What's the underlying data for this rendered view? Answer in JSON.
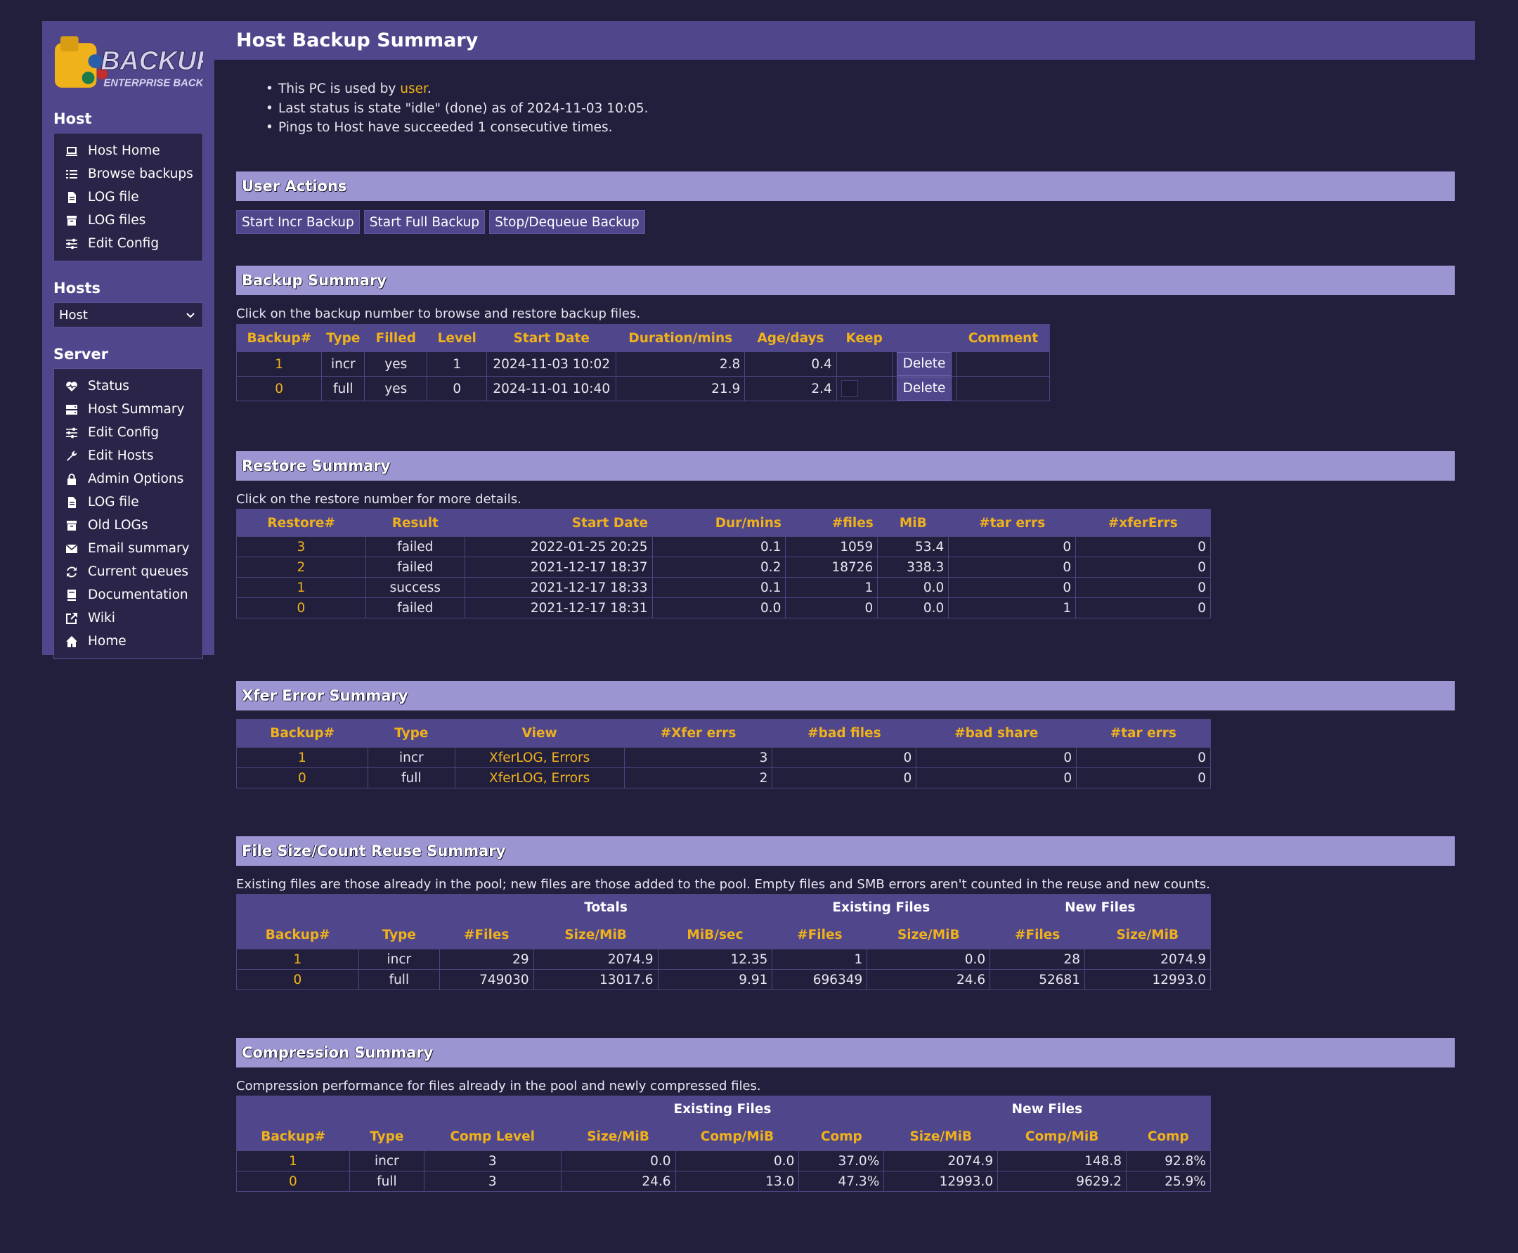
{
  "page": {
    "title": "Host Backup Summary"
  },
  "logo": {
    "main": "BACKUP PC",
    "sub": "ENTERPRISE BACKUP"
  },
  "sidebar": {
    "host_heading": "Host",
    "host_items": [
      {
        "label": "Host Home",
        "icon": "laptop-icon"
      },
      {
        "label": "Browse backups",
        "icon": "list-icon"
      },
      {
        "label": "LOG file",
        "icon": "file-icon"
      },
      {
        "label": "LOG files",
        "icon": "archive-icon"
      },
      {
        "label": "Edit Config",
        "icon": "sliders-icon"
      }
    ],
    "hosts_heading": "Hosts",
    "host_select_value": "Host",
    "server_heading": "Server",
    "server_items": [
      {
        "label": "Status",
        "icon": "heartbeat-icon"
      },
      {
        "label": "Host Summary",
        "icon": "server-icon"
      },
      {
        "label": "Edit Config",
        "icon": "sliders-icon"
      },
      {
        "label": "Edit Hosts",
        "icon": "wrench-icon"
      },
      {
        "label": "Admin Options",
        "icon": "lock-icon"
      },
      {
        "label": "LOG file",
        "icon": "file-icon"
      },
      {
        "label": "Old LOGs",
        "icon": "archive-icon"
      },
      {
        "label": "Email summary",
        "icon": "envelope-icon"
      },
      {
        "label": "Current queues",
        "icon": "refresh-icon"
      },
      {
        "label": "Documentation",
        "icon": "book-icon"
      },
      {
        "label": "Wiki",
        "icon": "external-link-icon"
      },
      {
        "label": "Home",
        "icon": "home-icon"
      }
    ]
  },
  "info": {
    "line1_pre": "This PC is used by ",
    "line1_user": "user",
    "line1_post": ".",
    "line2": "Last status is state \"idle\" (done) as of 2024-11-03 10:05.",
    "line3": "Pings to Host have succeeded 1 consecutive times."
  },
  "user_actions": {
    "heading": "User Actions",
    "buttons": [
      "Start Incr Backup",
      "Start Full Backup",
      "Stop/Dequeue Backup"
    ]
  },
  "backup_summary": {
    "heading": "Backup Summary",
    "desc": "Click on the backup number to browse and restore backup files.",
    "headers": [
      "Backup#",
      "Type",
      "Filled",
      "Level",
      "Start Date",
      "Duration/mins",
      "Age/days",
      "Keep",
      "",
      "Comment"
    ],
    "delete_label": "Delete",
    "rows": [
      {
        "num": "1",
        "type": "incr",
        "filled": "yes",
        "level": "1",
        "start": "2024-11-03 10:02",
        "dur": "2.8",
        "age": "0.4",
        "keep": ""
      },
      {
        "num": "0",
        "type": "full",
        "filled": "yes",
        "level": "0",
        "start": "2024-11-01 10:40",
        "dur": "21.9",
        "age": "2.4",
        "keep": ""
      }
    ]
  },
  "restore_summary": {
    "heading": "Restore Summary",
    "desc": "Click on the restore number for more details.",
    "headers": [
      "Restore#",
      "Result",
      "Start Date",
      "Dur/mins",
      "#files",
      "MiB",
      "#tar errs",
      "#xferErrs"
    ],
    "rows": [
      [
        "3",
        "failed",
        "2022-01-25 20:25",
        "0.1",
        "1059",
        "53.4",
        "0",
        "0"
      ],
      [
        "2",
        "failed",
        "2021-12-17 18:37",
        "0.2",
        "18726",
        "338.3",
        "0",
        "0"
      ],
      [
        "1",
        "success",
        "2021-12-17 18:33",
        "0.1",
        "1",
        "0.0",
        "0",
        "0"
      ],
      [
        "0",
        "failed",
        "2021-12-17 18:31",
        "0.0",
        "0",
        "0.0",
        "1",
        "0"
      ]
    ]
  },
  "xfer_summary": {
    "heading": "Xfer Error Summary",
    "headers": [
      "Backup#",
      "Type",
      "View",
      "#Xfer errs",
      "#bad files",
      "#bad share",
      "#tar errs"
    ],
    "view_link1": "XferLOG",
    "view_sep": ", ",
    "view_link2": "Errors",
    "rows": [
      [
        "1",
        "incr",
        "3",
        "0",
        "0",
        "0"
      ],
      [
        "0",
        "full",
        "2",
        "0",
        "0",
        "0"
      ]
    ]
  },
  "reuse_summary": {
    "heading": "File Size/Count Reuse Summary",
    "desc": "Existing files are those already in the pool; new files are those added to the pool. Empty files and SMB errors aren't counted in the reuse and new counts.",
    "groups": [
      "Totals",
      "Existing Files",
      "New Files"
    ],
    "headers": [
      "Backup#",
      "Type",
      "#Files",
      "Size/MiB",
      "MiB/sec",
      "#Files",
      "Size/MiB",
      "#Files",
      "Size/MiB"
    ],
    "rows": [
      [
        "1",
        "incr",
        "29",
        "2074.9",
        "12.35",
        "1",
        "0.0",
        "28",
        "2074.9"
      ],
      [
        "0",
        "full",
        "749030",
        "13017.6",
        "9.91",
        "696349",
        "24.6",
        "52681",
        "12993.0"
      ]
    ]
  },
  "compression_summary": {
    "heading": "Compression Summary",
    "desc": "Compression performance for files already in the pool and newly compressed files.",
    "groups": [
      "Existing Files",
      "New Files"
    ],
    "headers": [
      "Backup#",
      "Type",
      "Comp Level",
      "Size/MiB",
      "Comp/MiB",
      "Comp",
      "Size/MiB",
      "Comp/MiB",
      "Comp"
    ],
    "rows": [
      [
        "1",
        "incr",
        "3",
        "0.0",
        "0.0",
        "37.0%",
        "2074.9",
        "148.8",
        "92.8%"
      ],
      [
        "0",
        "full",
        "3",
        "24.6",
        "13.0",
        "47.3%",
        "12993.0",
        "9629.2",
        "25.9%"
      ]
    ]
  },
  "colors": {
    "accent": "#f0b21a",
    "panel": "#4f468c",
    "section": "#9b96d2",
    "background": "#221f3c"
  }
}
